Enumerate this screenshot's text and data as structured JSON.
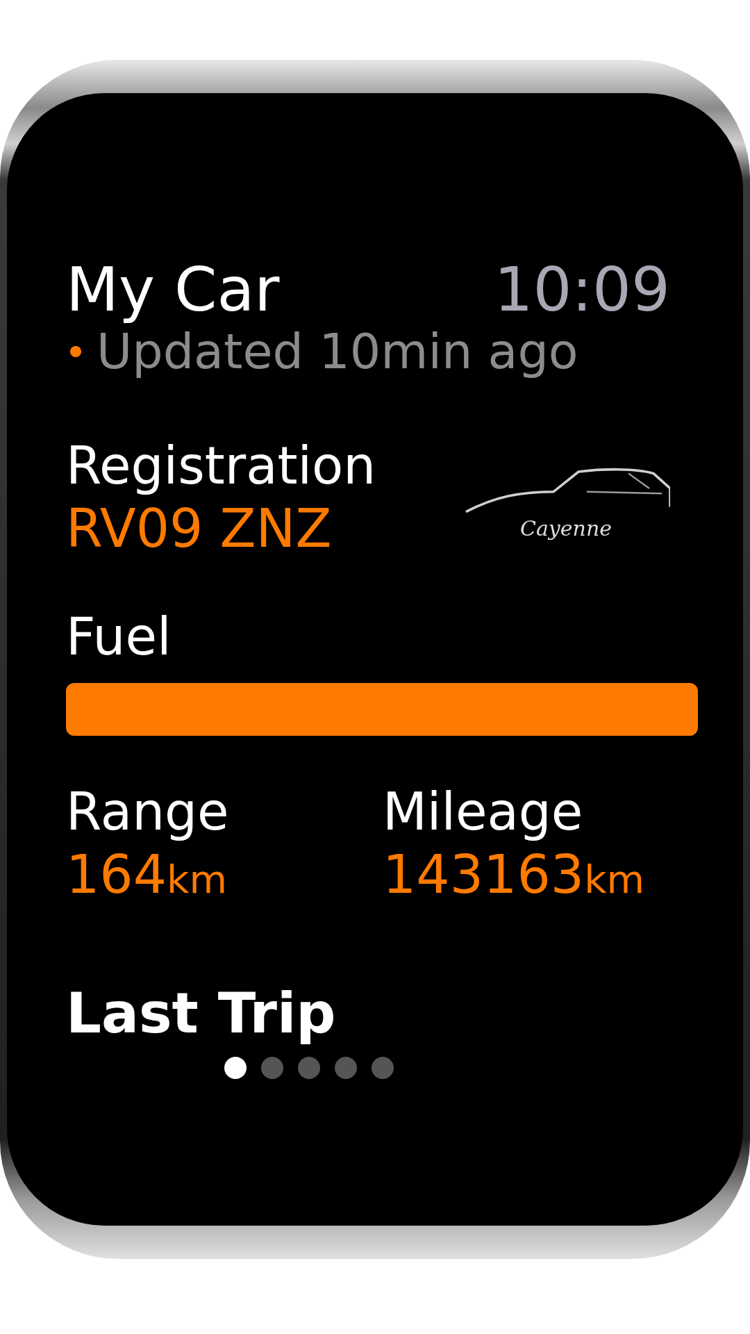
{
  "header": {
    "title": "My Car",
    "time": "10:09"
  },
  "status": {
    "text": "Updated 10min ago",
    "color": "#ff7a00"
  },
  "registration": {
    "label": "Registration",
    "value": "RV09 ZNZ",
    "model_logo": "Cayenne"
  },
  "fuel": {
    "label": "Fuel",
    "level": 1.0
  },
  "stats": [
    {
      "label": "Range",
      "value": "164",
      "unit": "km"
    },
    {
      "label": "Mileage",
      "value": "143163",
      "unit": "km"
    }
  ],
  "section_title": "Last Trip",
  "pages": [
    {
      "selected": true
    },
    {
      "selected": false
    },
    {
      "selected": false
    },
    {
      "selected": false
    },
    {
      "selected": false
    }
  ]
}
